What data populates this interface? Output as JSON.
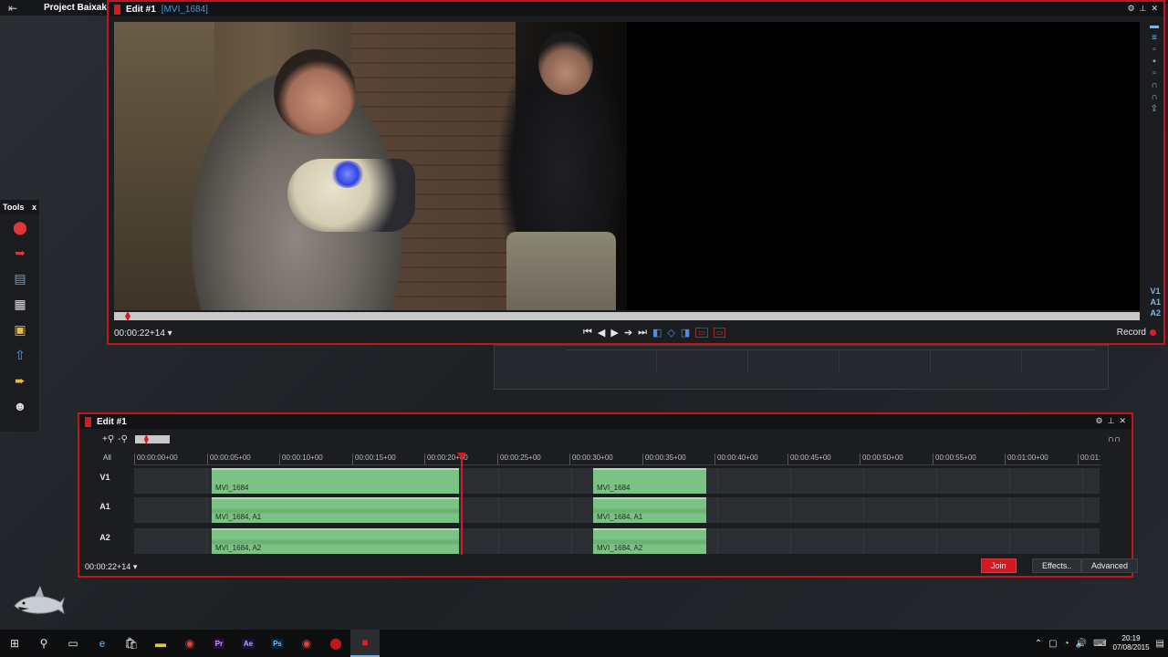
{
  "project": {
    "name": "Project Baixaki",
    "exit_icon": "exit-icon"
  },
  "viewer": {
    "title": "Edit #1",
    "clip_name": "[MVI_1684]",
    "timecode": "00:00:22+14",
    "timecode_arrow": "▾",
    "record_label": "Record",
    "track_labels": [
      "V1",
      "A1",
      "A2"
    ],
    "transport": [
      "⏮",
      "◀",
      "▶",
      "▶",
      "⏭"
    ]
  },
  "tools": {
    "title": "Tools",
    "close": "x",
    "items": [
      "record-icon",
      "import-icon",
      "timeline-icon",
      "storyboard-icon",
      "browser-icon",
      "export-icon",
      "forward-icon",
      "users-icon"
    ]
  },
  "timeline": {
    "title": "Edit #1",
    "all_label": "All",
    "zoom_in": "+⚲",
    "zoom_out": "-⚲",
    "ruler": [
      "00:00:00+00",
      "00:00:05+00",
      "00:00:10+00",
      "00:00:15+00",
      "00:00:20+00",
      "00:00:25+00",
      "00:00:30+00",
      "00:00:35+00",
      "00:00:40+00",
      "00:00:45+00",
      "00:00:50+00",
      "00:00:55+00",
      "00:01:00+00",
      "00:01:"
    ],
    "tracks": [
      {
        "label": "V1",
        "clips": [
          "MVI_1684",
          "MVI_1684"
        ]
      },
      {
        "label": "A1",
        "clips": [
          "MVI_1684, A1",
          "MVI_1684, A1"
        ]
      },
      {
        "label": "A2",
        "clips": [
          "MVI_1684, A2",
          "MVI_1684, A2"
        ]
      }
    ],
    "timecode": "00:00:22+14",
    "timecode_arrow": "▾",
    "buttons": {
      "join": "Join",
      "effects": "Effects..",
      "advanced": "Advanced"
    }
  },
  "taskbar": {
    "apps": [
      "Pr",
      "Ae",
      "Ps"
    ],
    "clock_time": "20:19",
    "clock_date": "07/08/2015"
  },
  "colors": {
    "accent": "#c0161e",
    "clip": "#7cc285",
    "highlight": "#4f9ad6"
  }
}
